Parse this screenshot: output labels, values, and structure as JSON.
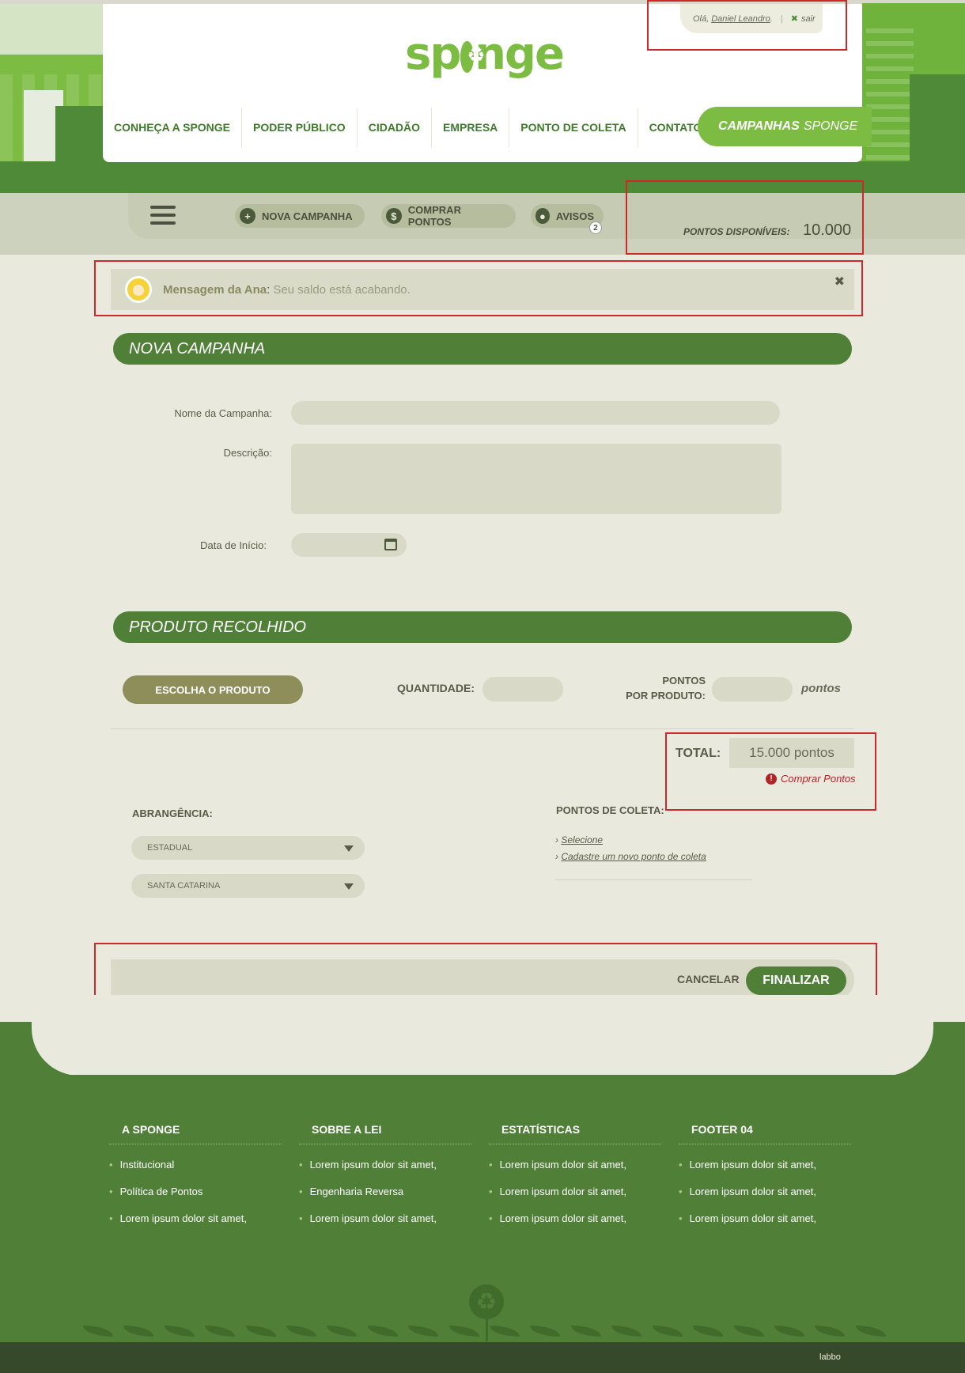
{
  "header": {
    "greeting": "Olá,",
    "user_name": "Daniel Leandro",
    "logout": "sair",
    "logo_text_left": "sp",
    "logo_text_right": "nge",
    "nav": [
      "CONHEÇA A SPONGE",
      "PODER PÚBLICO",
      "CIDADÃO",
      "EMPRESA",
      "PONTO DE COLETA",
      "CONTATO"
    ],
    "campanhas_bold": "CAMPANHAS",
    "campanhas_light": "SPONGE"
  },
  "toolbar": {
    "nova_campanha": "NOVA CAMPANHA",
    "comprar_pontos": "COMPRAR PONTOS",
    "avisos": "AVISOS",
    "avisos_count": "2",
    "points_label": "PONTOS DISPONÍVEIS:",
    "points_value": "10.000"
  },
  "message": {
    "from": "Mensagem da Ana",
    "text": "Seu saldo está acabando."
  },
  "nova_campanha": {
    "title": "NOVA CAMPANHA",
    "name_label": "Nome da Campanha:",
    "desc_label": "Descrição:",
    "start_label": "Data de Início:"
  },
  "produto": {
    "title": "PRODUTO RECOLHIDO",
    "choose_button": "ESCOLHA O PRODUTO",
    "quantidade_label": "QUANTIDADE:",
    "pontos_label_1": "PONTOS",
    "pontos_label_2": "POR PRODUTO:",
    "pontos_unit": "pontos",
    "total_label": "TOTAL:",
    "total_value": "15.000 pontos",
    "buy_link": "Comprar Pontos",
    "abrangencia_label": "ABRANGÊNCIA:",
    "abrangencia_value": "ESTADUAL",
    "estado_value": "SANTA CATARINA",
    "pontos_coleta_label": "PONTOS DE COLETA:",
    "link_selecione": "Selecione",
    "link_cadastre": "Cadastre um novo ponto de coleta"
  },
  "actions": {
    "cancel": "CANCELAR",
    "finish": "FINALIZAR"
  },
  "footer": {
    "columns": [
      {
        "title": "A SPONGE",
        "items": [
          "Institucional",
          "Política de Pontos",
          "Lorem ipsum dolor sit amet,"
        ]
      },
      {
        "title": "SOBRE A LEI",
        "items": [
          "Lorem ipsum dolor sit amet,",
          "Engenharia Reversa",
          "Lorem ipsum dolor sit amet,"
        ]
      },
      {
        "title": "ESTATÍSTICAS",
        "items": [
          "Lorem ipsum dolor sit amet,",
          "Lorem ipsum dolor sit amet,",
          "Lorem ipsum dolor sit amet,"
        ]
      },
      {
        "title": "FOOTER 04",
        "items": [
          "Lorem ipsum dolor sit amet,",
          "Lorem ipsum dolor sit amet,",
          "Lorem ipsum dolor sit amet,"
        ]
      }
    ],
    "credit": "labbo"
  },
  "colors": {
    "brand_green": "#7cbc42",
    "dark_green": "#508038",
    "alert_red": "#b02525"
  }
}
